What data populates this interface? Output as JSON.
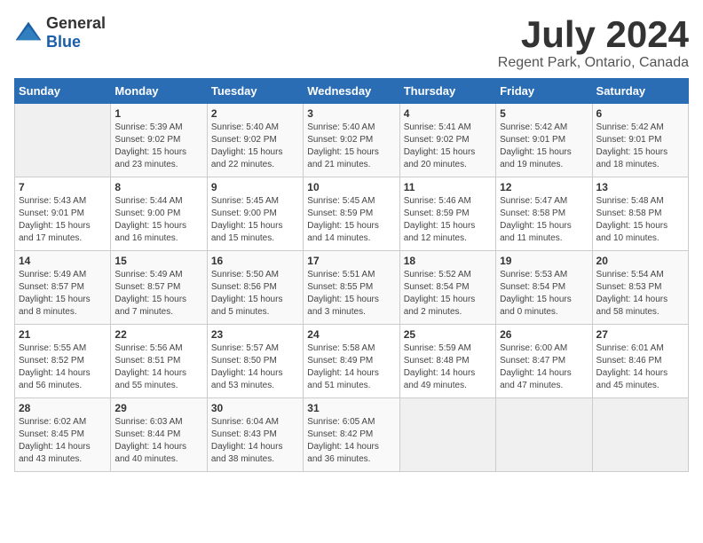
{
  "logo": {
    "text_general": "General",
    "text_blue": "Blue"
  },
  "header": {
    "month": "July 2024",
    "location": "Regent Park, Ontario, Canada"
  },
  "weekdays": [
    "Sunday",
    "Monday",
    "Tuesday",
    "Wednesday",
    "Thursday",
    "Friday",
    "Saturday"
  ],
  "weeks": [
    [
      {
        "day": "",
        "detail": ""
      },
      {
        "day": "1",
        "detail": "Sunrise: 5:39 AM\nSunset: 9:02 PM\nDaylight: 15 hours\nand 23 minutes."
      },
      {
        "day": "2",
        "detail": "Sunrise: 5:40 AM\nSunset: 9:02 PM\nDaylight: 15 hours\nand 22 minutes."
      },
      {
        "day": "3",
        "detail": "Sunrise: 5:40 AM\nSunset: 9:02 PM\nDaylight: 15 hours\nand 21 minutes."
      },
      {
        "day": "4",
        "detail": "Sunrise: 5:41 AM\nSunset: 9:02 PM\nDaylight: 15 hours\nand 20 minutes."
      },
      {
        "day": "5",
        "detail": "Sunrise: 5:42 AM\nSunset: 9:01 PM\nDaylight: 15 hours\nand 19 minutes."
      },
      {
        "day": "6",
        "detail": "Sunrise: 5:42 AM\nSunset: 9:01 PM\nDaylight: 15 hours\nand 18 minutes."
      }
    ],
    [
      {
        "day": "7",
        "detail": "Sunrise: 5:43 AM\nSunset: 9:01 PM\nDaylight: 15 hours\nand 17 minutes."
      },
      {
        "day": "8",
        "detail": "Sunrise: 5:44 AM\nSunset: 9:00 PM\nDaylight: 15 hours\nand 16 minutes."
      },
      {
        "day": "9",
        "detail": "Sunrise: 5:45 AM\nSunset: 9:00 PM\nDaylight: 15 hours\nand 15 minutes."
      },
      {
        "day": "10",
        "detail": "Sunrise: 5:45 AM\nSunset: 8:59 PM\nDaylight: 15 hours\nand 14 minutes."
      },
      {
        "day": "11",
        "detail": "Sunrise: 5:46 AM\nSunset: 8:59 PM\nDaylight: 15 hours\nand 12 minutes."
      },
      {
        "day": "12",
        "detail": "Sunrise: 5:47 AM\nSunset: 8:58 PM\nDaylight: 15 hours\nand 11 minutes."
      },
      {
        "day": "13",
        "detail": "Sunrise: 5:48 AM\nSunset: 8:58 PM\nDaylight: 15 hours\nand 10 minutes."
      }
    ],
    [
      {
        "day": "14",
        "detail": "Sunrise: 5:49 AM\nSunset: 8:57 PM\nDaylight: 15 hours\nand 8 minutes."
      },
      {
        "day": "15",
        "detail": "Sunrise: 5:49 AM\nSunset: 8:57 PM\nDaylight: 15 hours\nand 7 minutes."
      },
      {
        "day": "16",
        "detail": "Sunrise: 5:50 AM\nSunset: 8:56 PM\nDaylight: 15 hours\nand 5 minutes."
      },
      {
        "day": "17",
        "detail": "Sunrise: 5:51 AM\nSunset: 8:55 PM\nDaylight: 15 hours\nand 3 minutes."
      },
      {
        "day": "18",
        "detail": "Sunrise: 5:52 AM\nSunset: 8:54 PM\nDaylight: 15 hours\nand 2 minutes."
      },
      {
        "day": "19",
        "detail": "Sunrise: 5:53 AM\nSunset: 8:54 PM\nDaylight: 15 hours\nand 0 minutes."
      },
      {
        "day": "20",
        "detail": "Sunrise: 5:54 AM\nSunset: 8:53 PM\nDaylight: 14 hours\nand 58 minutes."
      }
    ],
    [
      {
        "day": "21",
        "detail": "Sunrise: 5:55 AM\nSunset: 8:52 PM\nDaylight: 14 hours\nand 56 minutes."
      },
      {
        "day": "22",
        "detail": "Sunrise: 5:56 AM\nSunset: 8:51 PM\nDaylight: 14 hours\nand 55 minutes."
      },
      {
        "day": "23",
        "detail": "Sunrise: 5:57 AM\nSunset: 8:50 PM\nDaylight: 14 hours\nand 53 minutes."
      },
      {
        "day": "24",
        "detail": "Sunrise: 5:58 AM\nSunset: 8:49 PM\nDaylight: 14 hours\nand 51 minutes."
      },
      {
        "day": "25",
        "detail": "Sunrise: 5:59 AM\nSunset: 8:48 PM\nDaylight: 14 hours\nand 49 minutes."
      },
      {
        "day": "26",
        "detail": "Sunrise: 6:00 AM\nSunset: 8:47 PM\nDaylight: 14 hours\nand 47 minutes."
      },
      {
        "day": "27",
        "detail": "Sunrise: 6:01 AM\nSunset: 8:46 PM\nDaylight: 14 hours\nand 45 minutes."
      }
    ],
    [
      {
        "day": "28",
        "detail": "Sunrise: 6:02 AM\nSunset: 8:45 PM\nDaylight: 14 hours\nand 43 minutes."
      },
      {
        "day": "29",
        "detail": "Sunrise: 6:03 AM\nSunset: 8:44 PM\nDaylight: 14 hours\nand 40 minutes."
      },
      {
        "day": "30",
        "detail": "Sunrise: 6:04 AM\nSunset: 8:43 PM\nDaylight: 14 hours\nand 38 minutes."
      },
      {
        "day": "31",
        "detail": "Sunrise: 6:05 AM\nSunset: 8:42 PM\nDaylight: 14 hours\nand 36 minutes."
      },
      {
        "day": "",
        "detail": ""
      },
      {
        "day": "",
        "detail": ""
      },
      {
        "day": "",
        "detail": ""
      }
    ]
  ]
}
